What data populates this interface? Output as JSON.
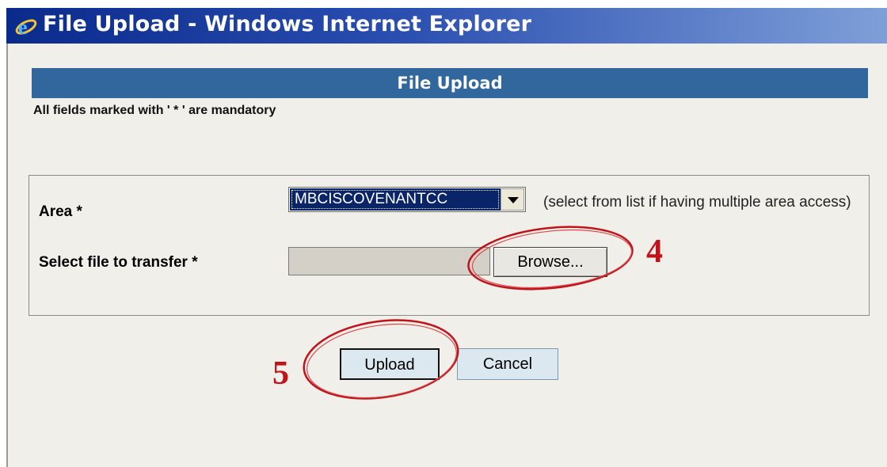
{
  "window": {
    "title": "File Upload - Windows Internet Explorer",
    "icon": "ie-logo-icon"
  },
  "page": {
    "header": "File Upload",
    "mandatory_note": "All fields marked with ' * ' are mandatory"
  },
  "form": {
    "area": {
      "label": "Area *",
      "selected": "MBCISCOVENANTCC",
      "hint": "(select from list if having multiple area access)"
    },
    "file": {
      "label": "Select file to transfer *",
      "value": "",
      "browse_label": "Browse..."
    }
  },
  "actions": {
    "upload_label": "Upload",
    "cancel_label": "Cancel"
  },
  "annotations": {
    "step4": "4",
    "step5": "5",
    "color": "#c0141a"
  },
  "colors": {
    "header_bar": "#31679c",
    "titlebar": "#0a2a8c",
    "selection": "#0a246a"
  }
}
